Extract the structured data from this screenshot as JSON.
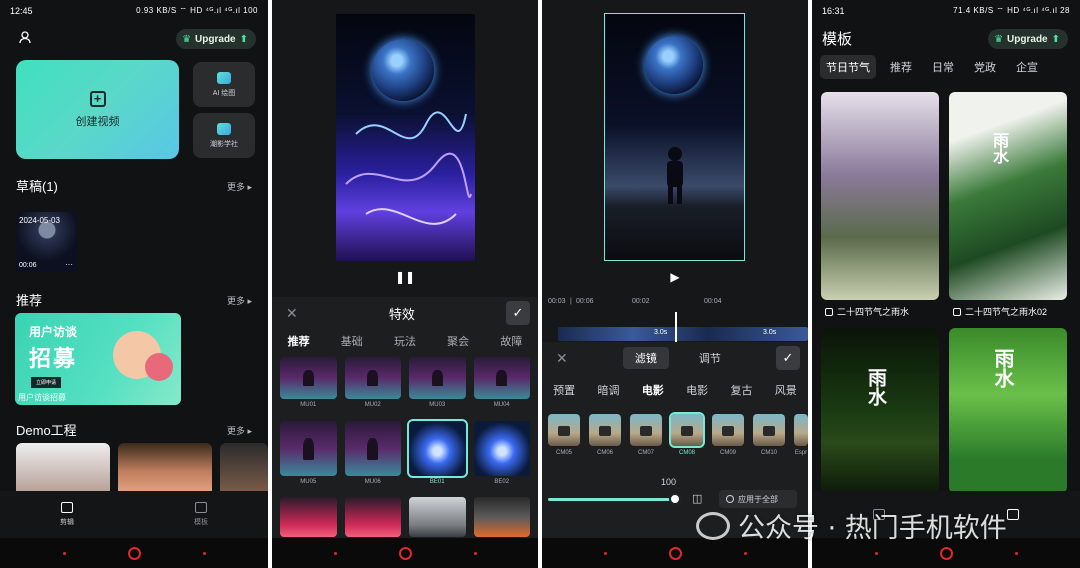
{
  "screen1": {
    "status": {
      "time": "12:45",
      "indicators": "0.93 KB/S ⌔ HD ⁴ᴳ.ıl ⁴ᴳ.ıl 100"
    },
    "upgrade_label": "Upgrade",
    "create_label": "创建视频",
    "ai_draw_label": "AI 绘图",
    "photo_school_label": "潮影学社",
    "drafts_title": "草稿(1)",
    "more_label": "更多",
    "draft": {
      "date": "2024-05-03",
      "duration": "00:06",
      "menu": "···"
    },
    "recommend_title": "推荐",
    "banner": {
      "line1": "用户访谈",
      "line2": "招募",
      "button": "立即申请",
      "caption": "用户访谈招募"
    },
    "demo_title": "Demo工程",
    "tabs": [
      {
        "label": "剪辑"
      },
      {
        "label": "模板"
      }
    ]
  },
  "screen2": {
    "sheet_title": "特效",
    "tabs": [
      "推荐",
      "基础",
      "玩法",
      "聚会",
      "故障"
    ],
    "items_row1": [
      "MU01",
      "MU02",
      "MU03",
      "MU04"
    ],
    "items_row2": [
      "MU05",
      "MU06",
      "BE01",
      "BE02"
    ],
    "pause_icon": "pause-icon"
  },
  "screen3": {
    "time_current": "00:03",
    "time_total": "00:06",
    "ticks": [
      "00:02",
      "00:04"
    ],
    "clip1": "3.0s",
    "clip2": "3.0s",
    "tab_filter": "滤镜",
    "tab_adjust": "调节",
    "categories": [
      "预置",
      "暗调",
      "电影",
      "电影",
      "复古",
      "风景"
    ],
    "filters": [
      "CM05",
      "CM06",
      "CM07",
      "CM08",
      "CM09",
      "CM10",
      "Espr"
    ],
    "intensity": 100,
    "apply_all": "应用于全部"
  },
  "screen4": {
    "status": {
      "time": "16:31",
      "indicators": "71.4 KB/S ⌔ HD ⁴ᴳ.ıl ⁴ᴳ.ıl 28"
    },
    "title": "模板",
    "upgrade_label": "Upgrade",
    "chips": [
      "节日节气",
      "推荐",
      "日常",
      "党政",
      "企宣"
    ],
    "card1_caption": "二十四节气之雨水",
    "card2_caption": "二十四节气之雨水02",
    "card2_text": "雨水",
    "card3_text": "雨水",
    "card4_text": "雨水"
  },
  "watermark": "公众号 · 热门手机软件",
  "colors": {
    "accent": "#7ae8d6",
    "nav_red": "#e0282e",
    "bg": "#111213"
  }
}
